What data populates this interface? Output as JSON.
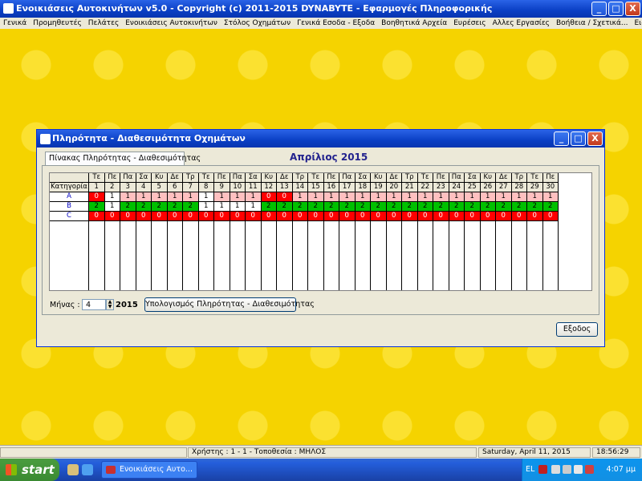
{
  "app": {
    "title": "Ενοικιάσεις Αυτοκινήτων  v5.0  -  Copyright (c)  2011-2015  DYNABYTE - Εφαρμογές Πληροφορικής",
    "minimize": "_",
    "maximize": "□",
    "close": "X"
  },
  "menu": [
    "Γενικά",
    "Προμηθευτές",
    "Πελάτες",
    "Ενοικιάσεις Αυτοκινήτων",
    "Στόλος Οχημάτων",
    "Γενικά Εσοδα - Εξοδα",
    "Βοηθητικά Αρχεία",
    "Ευρέσεις",
    "Αλλες Εργασίες",
    "Βοήθεια / Σχετικά...",
    "Ειδικές Εργασίες"
  ],
  "dialog": {
    "title": "Πληρότητα - Διαθεσιμότητα Οχημάτων",
    "tab": "Πίνακας Πληρότητας - Διαθεσιμότητας",
    "month_title": "Απρίλιος  2015",
    "month_label": "Μήνας :",
    "month_value": "4",
    "year": "2015",
    "calc_button": "Υπολογισμός Πληρότητας - Διαθεσιμότητας",
    "exit_button": "Εξοδος"
  },
  "grid": {
    "category_header": "Κατηγορία",
    "weekdays": [
      "Τε",
      "Πε",
      "Πα",
      "Σα",
      "Κυ",
      "Δε",
      "Τρ",
      "Τε",
      "Πε",
      "Πα",
      "Σα",
      "Κυ",
      "Δε",
      "Τρ",
      "Τε",
      "Πε",
      "Πα",
      "Σα",
      "Κυ",
      "Δε",
      "Τρ",
      "Τε",
      "Πε",
      "Πα",
      "Σα",
      "Κυ",
      "Δε",
      "Τρ",
      "Τε",
      "Πε"
    ],
    "days": [
      "1",
      "2",
      "3",
      "4",
      "5",
      "6",
      "7",
      "8",
      "9",
      "10",
      "11",
      "12",
      "13",
      "14",
      "15",
      "16",
      "17",
      "18",
      "19",
      "20",
      "21",
      "22",
      "23",
      "24",
      "25",
      "26",
      "27",
      "28",
      "29",
      "30"
    ],
    "rows": [
      {
        "category": "A",
        "values": [
          "0",
          "1",
          "1",
          "1",
          "1",
          "1",
          "1",
          "1",
          "1",
          "1",
          "1",
          "0",
          "0",
          "1",
          "1",
          "1",
          "1",
          "1",
          "1",
          "1",
          "1",
          "1",
          "1",
          "1",
          "1",
          "1",
          "1",
          "1",
          "1",
          "1"
        ],
        "colors": [
          "red",
          "white",
          "pink",
          "pink",
          "pink",
          "pink",
          "pink",
          "white",
          "pink",
          "pink",
          "pink",
          "red",
          "red",
          "pink",
          "pink",
          "pink",
          "pink",
          "pink",
          "pink",
          "pink",
          "pink",
          "pink",
          "pink",
          "pink",
          "pink",
          "pink",
          "pink",
          "pink",
          "pink",
          "pink"
        ]
      },
      {
        "category": "B",
        "values": [
          "2",
          "1",
          "2",
          "2",
          "2",
          "2",
          "2",
          "1",
          "1",
          "1",
          "1",
          "2",
          "2",
          "2",
          "2",
          "2",
          "2",
          "2",
          "2",
          "2",
          "2",
          "2",
          "2",
          "2",
          "2",
          "2",
          "2",
          "2",
          "2",
          "2"
        ],
        "colors": [
          "green",
          "white",
          "green",
          "green",
          "green",
          "green",
          "green",
          "white",
          "white",
          "white",
          "white",
          "green",
          "green",
          "green",
          "green",
          "green",
          "green",
          "green",
          "green",
          "green",
          "green",
          "green",
          "green",
          "green",
          "green",
          "green",
          "green",
          "green",
          "green",
          "green"
        ]
      },
      {
        "category": "C",
        "values": [
          "0",
          "0",
          "0",
          "0",
          "0",
          "0",
          "0",
          "0",
          "0",
          "0",
          "0",
          "0",
          "0",
          "0",
          "0",
          "0",
          "0",
          "0",
          "0",
          "0",
          "0",
          "0",
          "0",
          "0",
          "0",
          "0",
          "0",
          "0",
          "0",
          "0"
        ],
        "colors": [
          "red",
          "red",
          "red",
          "red",
          "red",
          "red",
          "red",
          "red",
          "red",
          "red",
          "red",
          "red",
          "red",
          "red",
          "red",
          "red",
          "red",
          "red",
          "red",
          "red",
          "red",
          "red",
          "red",
          "red",
          "red",
          "red",
          "red",
          "red",
          "red",
          "red"
        ]
      }
    ]
  },
  "status": {
    "user": "Χρήστης : 1 - 1  -  Τοποθεσία : ΜΗΛΟΣ",
    "date": "Saturday, April 11, 2015",
    "time": "18:56:29"
  },
  "taskbar": {
    "start": "start",
    "app_button": "Ενοικιάσεις Αυτο...",
    "lang": "EL",
    "clock": "4:07 μμ"
  }
}
